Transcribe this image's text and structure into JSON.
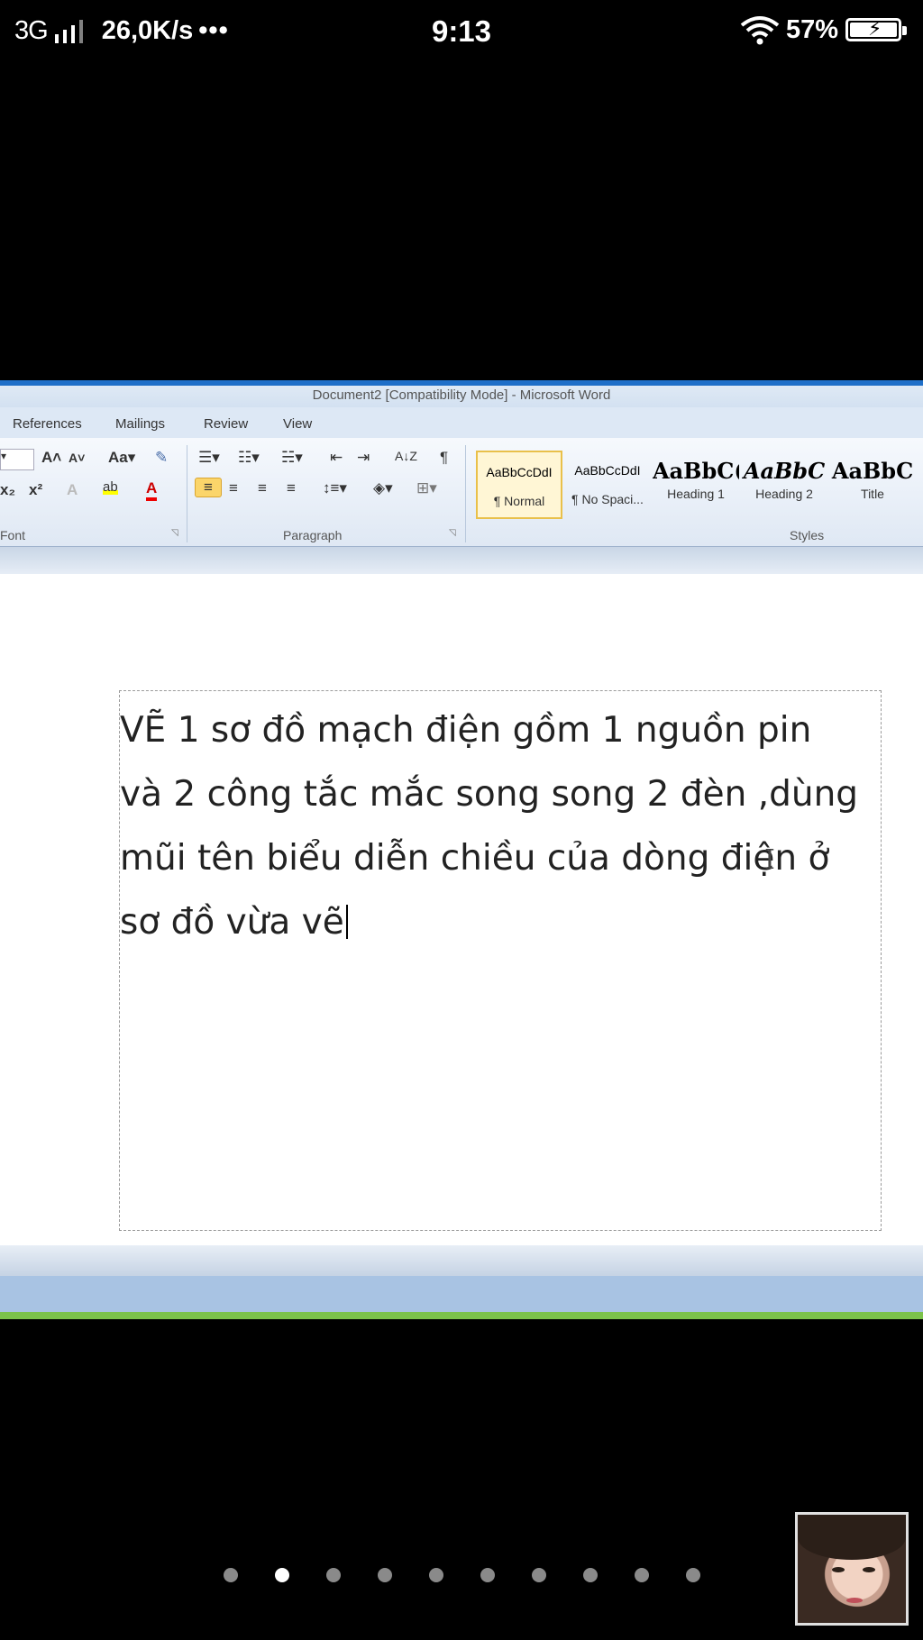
{
  "status_bar": {
    "network": "3G",
    "speed": "26,0K/s",
    "more": "•••",
    "time": "9:13",
    "battery": "57%"
  },
  "window": {
    "title": "Document2 [Compatibility Mode] - Microsoft Word"
  },
  "tabs": [
    "References",
    "Mailings",
    "Review",
    "View"
  ],
  "ribbon": {
    "groups": {
      "font": "Font",
      "paragraph": "Paragraph",
      "styles": "Styles"
    },
    "font_buttons": {
      "grow": "A˄",
      "shrink": "A˅",
      "change_case": "Aa▾",
      "subscript": "x₂",
      "superscript": "x²",
      "text_effects": "A",
      "highlight": "ab",
      "font_color": "A"
    },
    "paragraph_buttons": {
      "bullets": "☰▾",
      "numbering": "☷▾",
      "multilevel": "☵▾",
      "decrease_indent": "⇤",
      "increase_indent": "⇥",
      "sort": "A↓Z",
      "show_marks": "¶",
      "align_left": "≡",
      "center": "≡",
      "align_right": "≡",
      "justify": "≡",
      "line_spacing": "↕≡▾",
      "shading": "◈▾",
      "borders": "⊞▾"
    },
    "styles": [
      {
        "sample": "AaBbCcDdI",
        "name": "¶ Normal"
      },
      {
        "sample": "AaBbCcDdI",
        "name": "¶ No Spaci..."
      },
      {
        "sample": "AaBbC(",
        "name": "Heading 1"
      },
      {
        "sample": "AaBbC",
        "name": "Heading 2"
      },
      {
        "sample": "AaBbC",
        "name": "Title"
      }
    ]
  },
  "document": {
    "lines": [
      "VẼ 1 sơ đồ mạch điện gồm 1 nguồn pin",
      "và 2 công tắc mắc song song 2 đèn ,dùng",
      "mũi tên biểu diễn chiều của dòng điện ở",
      "sơ đồ vừa vẽ"
    ]
  },
  "pager": {
    "count": 10,
    "active_index": 1
  }
}
